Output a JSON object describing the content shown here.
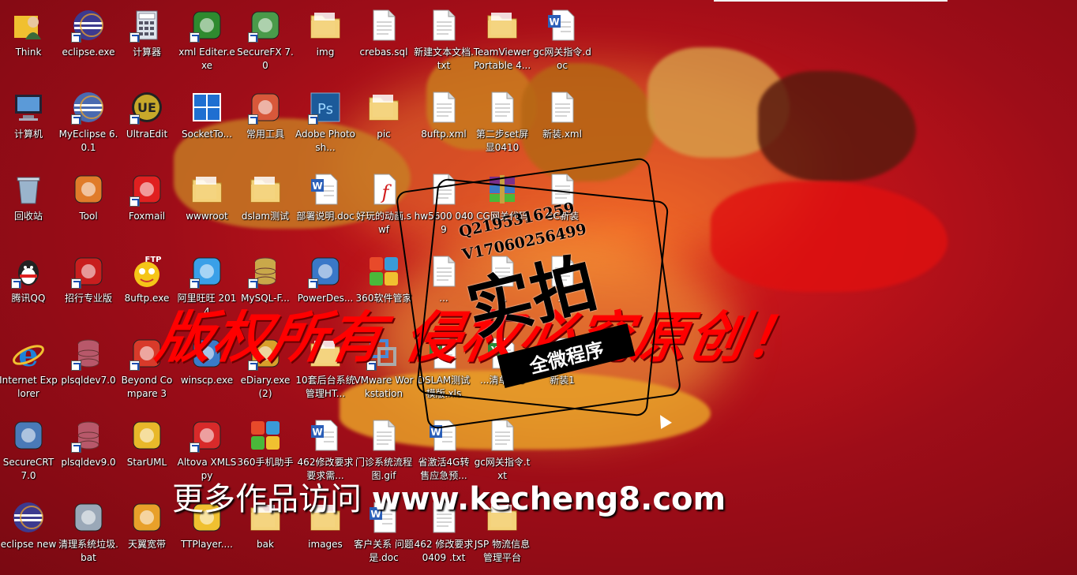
{
  "desktop": {
    "icons": [
      {
        "label": "Think",
        "icon": "user-icon",
        "shortcut": false,
        "color": "#f0c030"
      },
      {
        "label": "eclipse.exe",
        "icon": "eclipse-icon",
        "shortcut": true,
        "color": "#3d3a8f"
      },
      {
        "label": "计算器",
        "icon": "calculator-icon",
        "shortcut": true,
        "color": "#8aa6c8"
      },
      {
        "label": "xml Editer.exe",
        "icon": "xml-editor-icon",
        "shortcut": true,
        "color": "#2f8a2f"
      },
      {
        "label": "SecureFX 7.0",
        "icon": "securefx-icon",
        "shortcut": true,
        "color": "#4a9a4a"
      },
      {
        "label": "img",
        "icon": "folder-icon",
        "shortcut": false,
        "color": "#f3d27a"
      },
      {
        "label": "crebas.sql",
        "icon": "document-icon",
        "shortcut": false,
        "color": "#ffffff"
      },
      {
        "label": "新建文本文档.txt",
        "icon": "text-file-icon",
        "shortcut": false,
        "color": "#ffffff"
      },
      {
        "label": "TeamViewer Portable 4...",
        "icon": "folder-icon",
        "shortcut": false,
        "color": "#f3d27a"
      },
      {
        "label": "gc网关指令.doc",
        "icon": "word-document-icon",
        "shortcut": false,
        "color": "#2b5fb8"
      },
      {
        "label": "计算机",
        "icon": "computer-icon",
        "shortcut": false,
        "color": "#5b9ad8"
      },
      {
        "label": "MyEclipse 6.0.1",
        "icon": "myeclipse-icon",
        "shortcut": true,
        "color": "#4a6ab0"
      },
      {
        "label": "UltraEdit",
        "icon": "ultraedit-icon",
        "shortcut": true,
        "color": "#c7a82a"
      },
      {
        "label": "SocketTo...",
        "icon": "socket-tool-icon",
        "shortcut": false,
        "color": "#1f6fd1"
      },
      {
        "label": "常用工具",
        "icon": "toolbox-icon",
        "shortcut": true,
        "color": "#d8583a"
      },
      {
        "label": "Adobe Photosh...",
        "icon": "photoshop-icon",
        "shortcut": true,
        "color": "#1c5a9a"
      },
      {
        "label": "pic",
        "icon": "folder-icon",
        "shortcut": false,
        "color": "#f3d27a"
      },
      {
        "label": "8uftp.xml",
        "icon": "document-icon",
        "shortcut": false,
        "color": "#ffffff"
      },
      {
        "label": "第二步set屏显0410",
        "icon": "document-icon",
        "shortcut": false,
        "color": "#ffffff"
      },
      {
        "label": "新装.xml",
        "icon": "document-icon",
        "shortcut": false,
        "color": "#ffffff"
      },
      {
        "label": "回收站",
        "icon": "recycle-bin-icon",
        "shortcut": false,
        "color": "#9ab4cc"
      },
      {
        "label": "Tool",
        "icon": "tool-phone-icon",
        "shortcut": false,
        "color": "#e07b2a"
      },
      {
        "label": "Foxmail",
        "icon": "foxmail-icon",
        "shortcut": true,
        "color": "#e02020"
      },
      {
        "label": "wwwroot",
        "icon": "folder-icon",
        "shortcut": false,
        "color": "#f3d27a"
      },
      {
        "label": "dslam测试",
        "icon": "folder-icon",
        "shortcut": false,
        "color": "#f3d27a"
      },
      {
        "label": "部署说明.doc",
        "icon": "word-document-icon",
        "shortcut": false,
        "color": "#2b5fb8"
      },
      {
        "label": "好玩的动画.swf",
        "icon": "flash-icon",
        "shortcut": false,
        "color": "#d21e1e"
      },
      {
        "label": "hw5600 0409",
        "icon": "document-icon",
        "shortcut": false,
        "color": "#ffffff"
      },
      {
        "label": "CG网关代码",
        "icon": "archive-icon",
        "shortcut": false,
        "color": "#7a2f8a"
      },
      {
        "label": "GC新装",
        "icon": "document-icon",
        "shortcut": false,
        "color": "#ffffff"
      },
      {
        "label": "腾讯QQ",
        "icon": "qq-icon",
        "shortcut": true,
        "color": "#222222"
      },
      {
        "label": "招行专业版",
        "icon": "cmb-bank-icon",
        "shortcut": true,
        "color": "#c81e1e"
      },
      {
        "label": "8uftp.exe",
        "icon": "ftp-icon",
        "shortcut": false,
        "color": "#f5c518"
      },
      {
        "label": "阿里旺旺 2014",
        "icon": "aliwangwang-icon",
        "shortcut": true,
        "color": "#3aa0e8"
      },
      {
        "label": "MySQL-F...",
        "icon": "mysql-icon",
        "shortcut": true,
        "color": "#c9a84a"
      },
      {
        "label": "PowerDes...",
        "icon": "powerdesigner-icon",
        "shortcut": true,
        "color": "#3a78c8"
      },
      {
        "label": "360软件管家",
        "icon": "software-manager-icon",
        "shortcut": false,
        "color": "#e84a2a"
      },
      {
        "label": "...",
        "icon": "document-icon",
        "shortcut": false,
        "color": "#ffffff"
      },
      {
        "label": "...",
        "icon": "document-icon",
        "shortcut": false,
        "color": "#ffffff"
      },
      {
        "label": "...",
        "icon": "document-icon",
        "shortcut": false,
        "color": "#ffffff"
      },
      {
        "label": "Internet Explorer",
        "icon": "ie-icon",
        "shortcut": false,
        "color": "#1e82d8"
      },
      {
        "label": "plsqldev7.0",
        "icon": "plsql-icon",
        "shortcut": true,
        "color": "#b8586a"
      },
      {
        "label": "Beyond Compare 3",
        "icon": "beyond-compare-icon",
        "shortcut": true,
        "color": "#d83a2a"
      },
      {
        "label": "winscp.exe",
        "icon": "winscp-icon",
        "shortcut": false,
        "color": "#3a7ac8"
      },
      {
        "label": "eDiary.exe (2)",
        "icon": "ediary-icon",
        "shortcut": true,
        "color": "#d8a02a"
      },
      {
        "label": "10套后台系统管理HT...",
        "icon": "folder-icon",
        "shortcut": false,
        "color": "#f3d27a"
      },
      {
        "label": "VMware Workstation",
        "icon": "vmware-icon",
        "shortcut": true,
        "color": "#4a8ad8"
      },
      {
        "label": "DSLAM测试模版.xls",
        "icon": "excel-document-icon",
        "shortcut": false,
        "color": "#2a8a3a"
      },
      {
        "label": "...清单.xls",
        "icon": "excel-document-icon",
        "shortcut": false,
        "color": "#2a8a3a"
      },
      {
        "label": "新装1",
        "icon": "document-icon",
        "shortcut": false,
        "color": "#ffffff"
      },
      {
        "label": "SecureCRT 7.0",
        "icon": "securecrt-icon",
        "shortcut": false,
        "color": "#4a7ab8"
      },
      {
        "label": "plsqldev9.0",
        "icon": "plsql-icon",
        "shortcut": true,
        "color": "#b8586a"
      },
      {
        "label": "StarUML",
        "icon": "staruml-icon",
        "shortcut": false,
        "color": "#e8b82a"
      },
      {
        "label": "Altova XMLSpy",
        "icon": "xmlspy-icon",
        "shortcut": true,
        "color": "#d82a2a"
      },
      {
        "label": "360手机助手",
        "icon": "phone-assistant-icon",
        "shortcut": false,
        "color": "#4ab83a"
      },
      {
        "label": "462修改要求要求需...",
        "icon": "word-document-icon",
        "shortcut": false,
        "color": "#2b5fb8"
      },
      {
        "label": "门诊系统流程图.gif",
        "icon": "image-file-icon",
        "shortcut": false,
        "color": "#ffffff"
      },
      {
        "label": "省激活4G转售应急预...",
        "icon": "word-document-icon",
        "shortcut": false,
        "color": "#2b5fb8"
      },
      {
        "label": "gc网关指令.txt",
        "icon": "text-file-icon",
        "shortcut": false,
        "color": "#ffffff"
      },
      {
        "label": "eclipse new",
        "icon": "eclipse-icon",
        "shortcut": false,
        "color": "#3d3a8f"
      },
      {
        "label": "清理系统垃圾.bat",
        "icon": "batch-file-icon",
        "shortcut": false,
        "color": "#9aa8b8"
      },
      {
        "label": "天翼宽带",
        "icon": "tianyi-broadband-icon",
        "shortcut": false,
        "color": "#e8a02a"
      },
      {
        "label": "TTPlayer....",
        "icon": "ttplayer-icon",
        "shortcut": false,
        "color": "#f0c030"
      },
      {
        "label": "bak",
        "icon": "folder-icon",
        "shortcut": false,
        "color": "#f3d27a"
      },
      {
        "label": "images",
        "icon": "folder-icon",
        "shortcut": false,
        "color": "#f3d27a"
      },
      {
        "label": "客户关系 问题是.doc",
        "icon": "word-document-icon",
        "shortcut": false,
        "color": "#2b5fb8"
      },
      {
        "label": "462 修改要求0409 .txt",
        "icon": "text-file-icon",
        "shortcut": false,
        "color": "#ffffff"
      },
      {
        "label": "JSP 物流信息管理平台",
        "icon": "folder-icon",
        "shortcut": false,
        "color": "#f3d27a"
      }
    ]
  },
  "watermark": {
    "big_text": "版权所有 侵权必究原创！",
    "visit_text": "更多作品访问",
    "url": "www.kecheng8.com",
    "stamp_title": "实拍",
    "stamp_ribbon": "全微程序",
    "stamp_q": "Q2195316259",
    "stamp_v": "V17060256499"
  }
}
